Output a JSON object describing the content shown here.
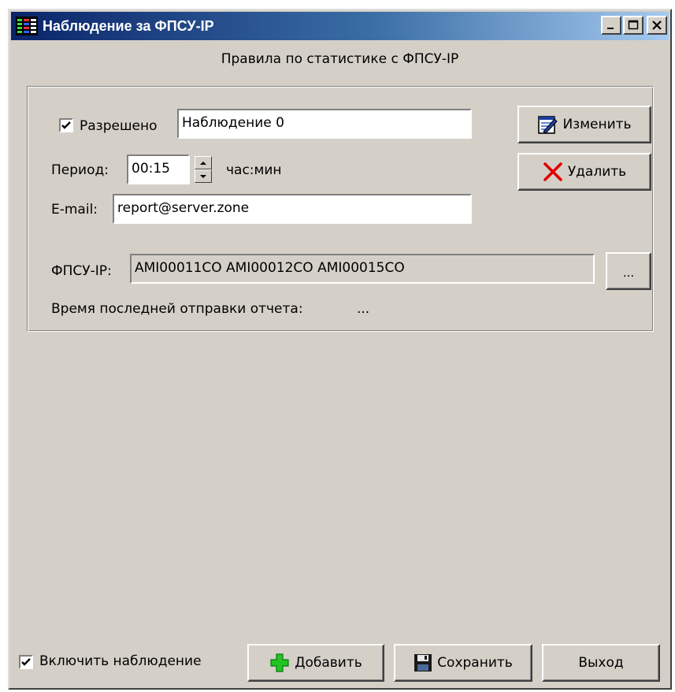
{
  "window": {
    "title": "Наблюдение за ФПСУ-IP"
  },
  "header": {
    "label": "Правила по статистике с ФПСУ-IP"
  },
  "rule": {
    "enabled_label": "Разрешено",
    "enabled_checked": true,
    "name_value": "Наблюдение 0",
    "period_label": "Период:",
    "period_value": "00:15",
    "period_unit": "час:мин",
    "email_label": "E-mail:",
    "email_value": "report@server.zone",
    "fpsu_label": "ФПСУ-IP:",
    "fpsu_value": "AMI00011CO AMI00012CO AMI00015CO",
    "browse_label": "...",
    "last_report_label": "Время последней отправки отчета:",
    "last_report_value": "...",
    "edit_button": "Изменить",
    "delete_button": "Удалить"
  },
  "footer": {
    "monitor_label": "Включить наблюдение",
    "monitor_checked": true,
    "add_button": "Добавить",
    "save_button": "Сохранить",
    "exit_button": "Выход"
  },
  "icons": {
    "app": "grid-app-icon",
    "edit": "notepad-edit-icon",
    "delete": "red-x-icon",
    "add": "green-plus-icon",
    "save": "floppy-disk-icon"
  },
  "colors": {
    "titlebar_start": "#0a246a",
    "titlebar_end": "#a6caf0",
    "face": "#d4d0c8",
    "delete_red": "#e00000",
    "add_green": "#22c422"
  }
}
